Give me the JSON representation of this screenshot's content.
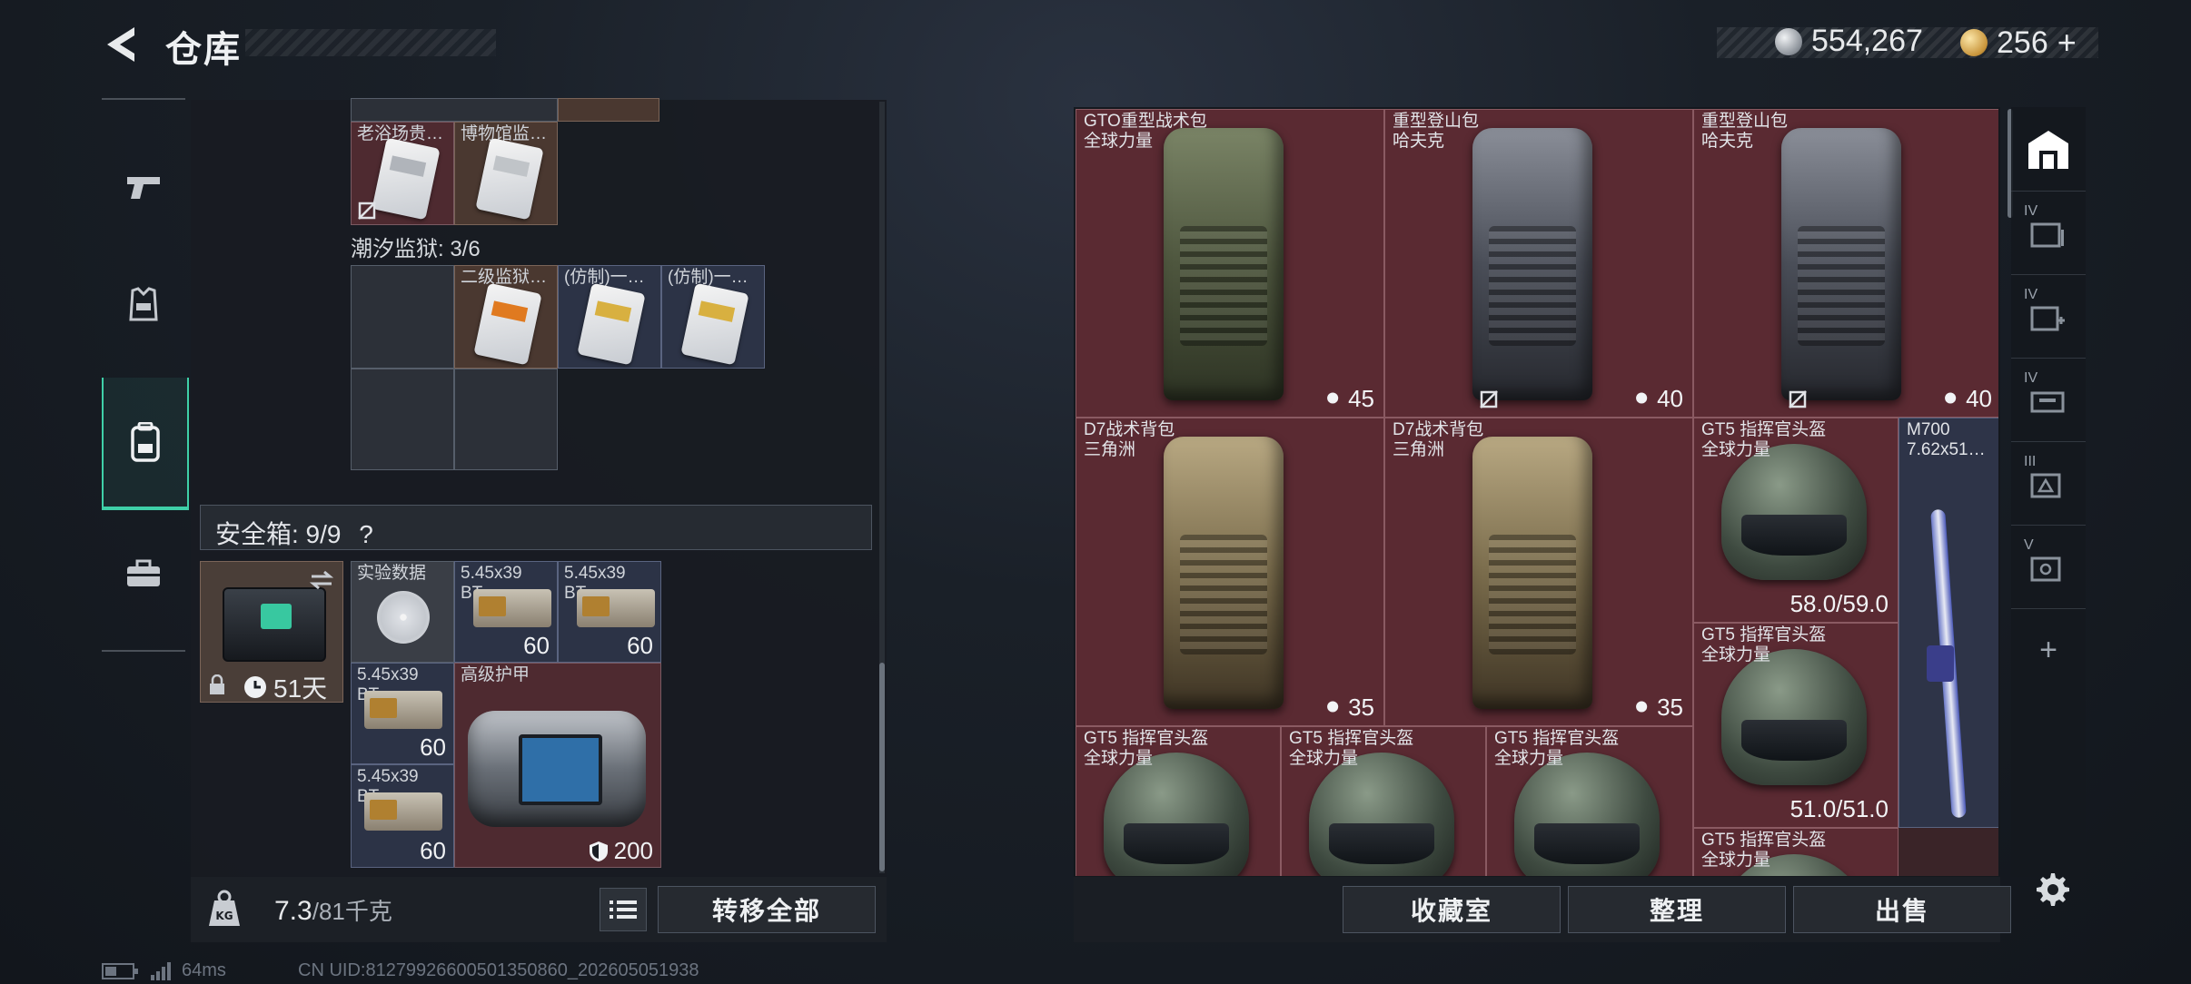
{
  "header": {
    "title": "仓库"
  },
  "currency": {
    "silver": "554,267",
    "gold": "256",
    "gold_add": "+"
  },
  "left_nav": [
    "weapon-icon",
    "armor-icon",
    "backpack-icon",
    "case-icon"
  ],
  "left_panel": {
    "row1_labels": [
      "老浴场贵…",
      "博物馆监…"
    ],
    "prison_section": "潮汐监狱: 3/6",
    "prison_labels": [
      "二级监狱…",
      "(仿制)一…",
      "(仿制)一…"
    ],
    "safe_box": {
      "label": "安全箱: 9/9",
      "help": "?",
      "timer": "51天"
    },
    "safe_items": [
      {
        "label": "实验数据",
        "count": ""
      },
      {
        "label": "5.45x39\nBT",
        "count": "60"
      },
      {
        "label": "5.45x39\nBT",
        "count": "60"
      },
      {
        "label": "5.45x39\nBT",
        "count": "60"
      },
      {
        "label": "高级护甲",
        "count": "200"
      },
      {
        "label": "5.45x39\nBT",
        "count": "60"
      }
    ],
    "weight": "7.3",
    "weight_max": "/81千克",
    "transfer_all": "转移全部"
  },
  "right_panel": {
    "items": [
      {
        "label": "GTO重型战术包\n全球力量",
        "value": "45"
      },
      {
        "label": "重型登山包\n哈夫克",
        "value": "40"
      },
      {
        "label": "重型登山包\n哈夫克",
        "value": "40"
      },
      {
        "label": "D7战术背包\n三角洲",
        "value": "35"
      },
      {
        "label": "D7战术背包\n三角洲",
        "value": "35"
      },
      {
        "label": "GT5 指挥官头盔\n全球力量",
        "value": "58.0/59.0"
      },
      {
        "label": "M700\n7.62x51…",
        "value": ""
      },
      {
        "label": "GT5 指挥官头盔\n全球力量",
        "value": "51.0/51.0"
      },
      {
        "label": "GT5 指挥官头盔\n全球力量",
        "value": ""
      },
      {
        "label": "GT5 指挥官头盔\n全球力量",
        "value": ""
      },
      {
        "label": "GT5 指挥官头盔\n全球力量",
        "value": ""
      },
      {
        "label": "GT5 指挥官头盔\n全球力量",
        "value": ""
      }
    ],
    "buttons": {
      "collection": "收藏室",
      "organize": "整理",
      "sell": "出售"
    }
  },
  "right_nav": {
    "add": "+",
    "tiers": [
      "IV",
      "IV",
      "IV",
      "III",
      "V"
    ]
  },
  "status": {
    "ping": "64ms",
    "uid": "CN UID:81279926600501350860_202605051938"
  }
}
